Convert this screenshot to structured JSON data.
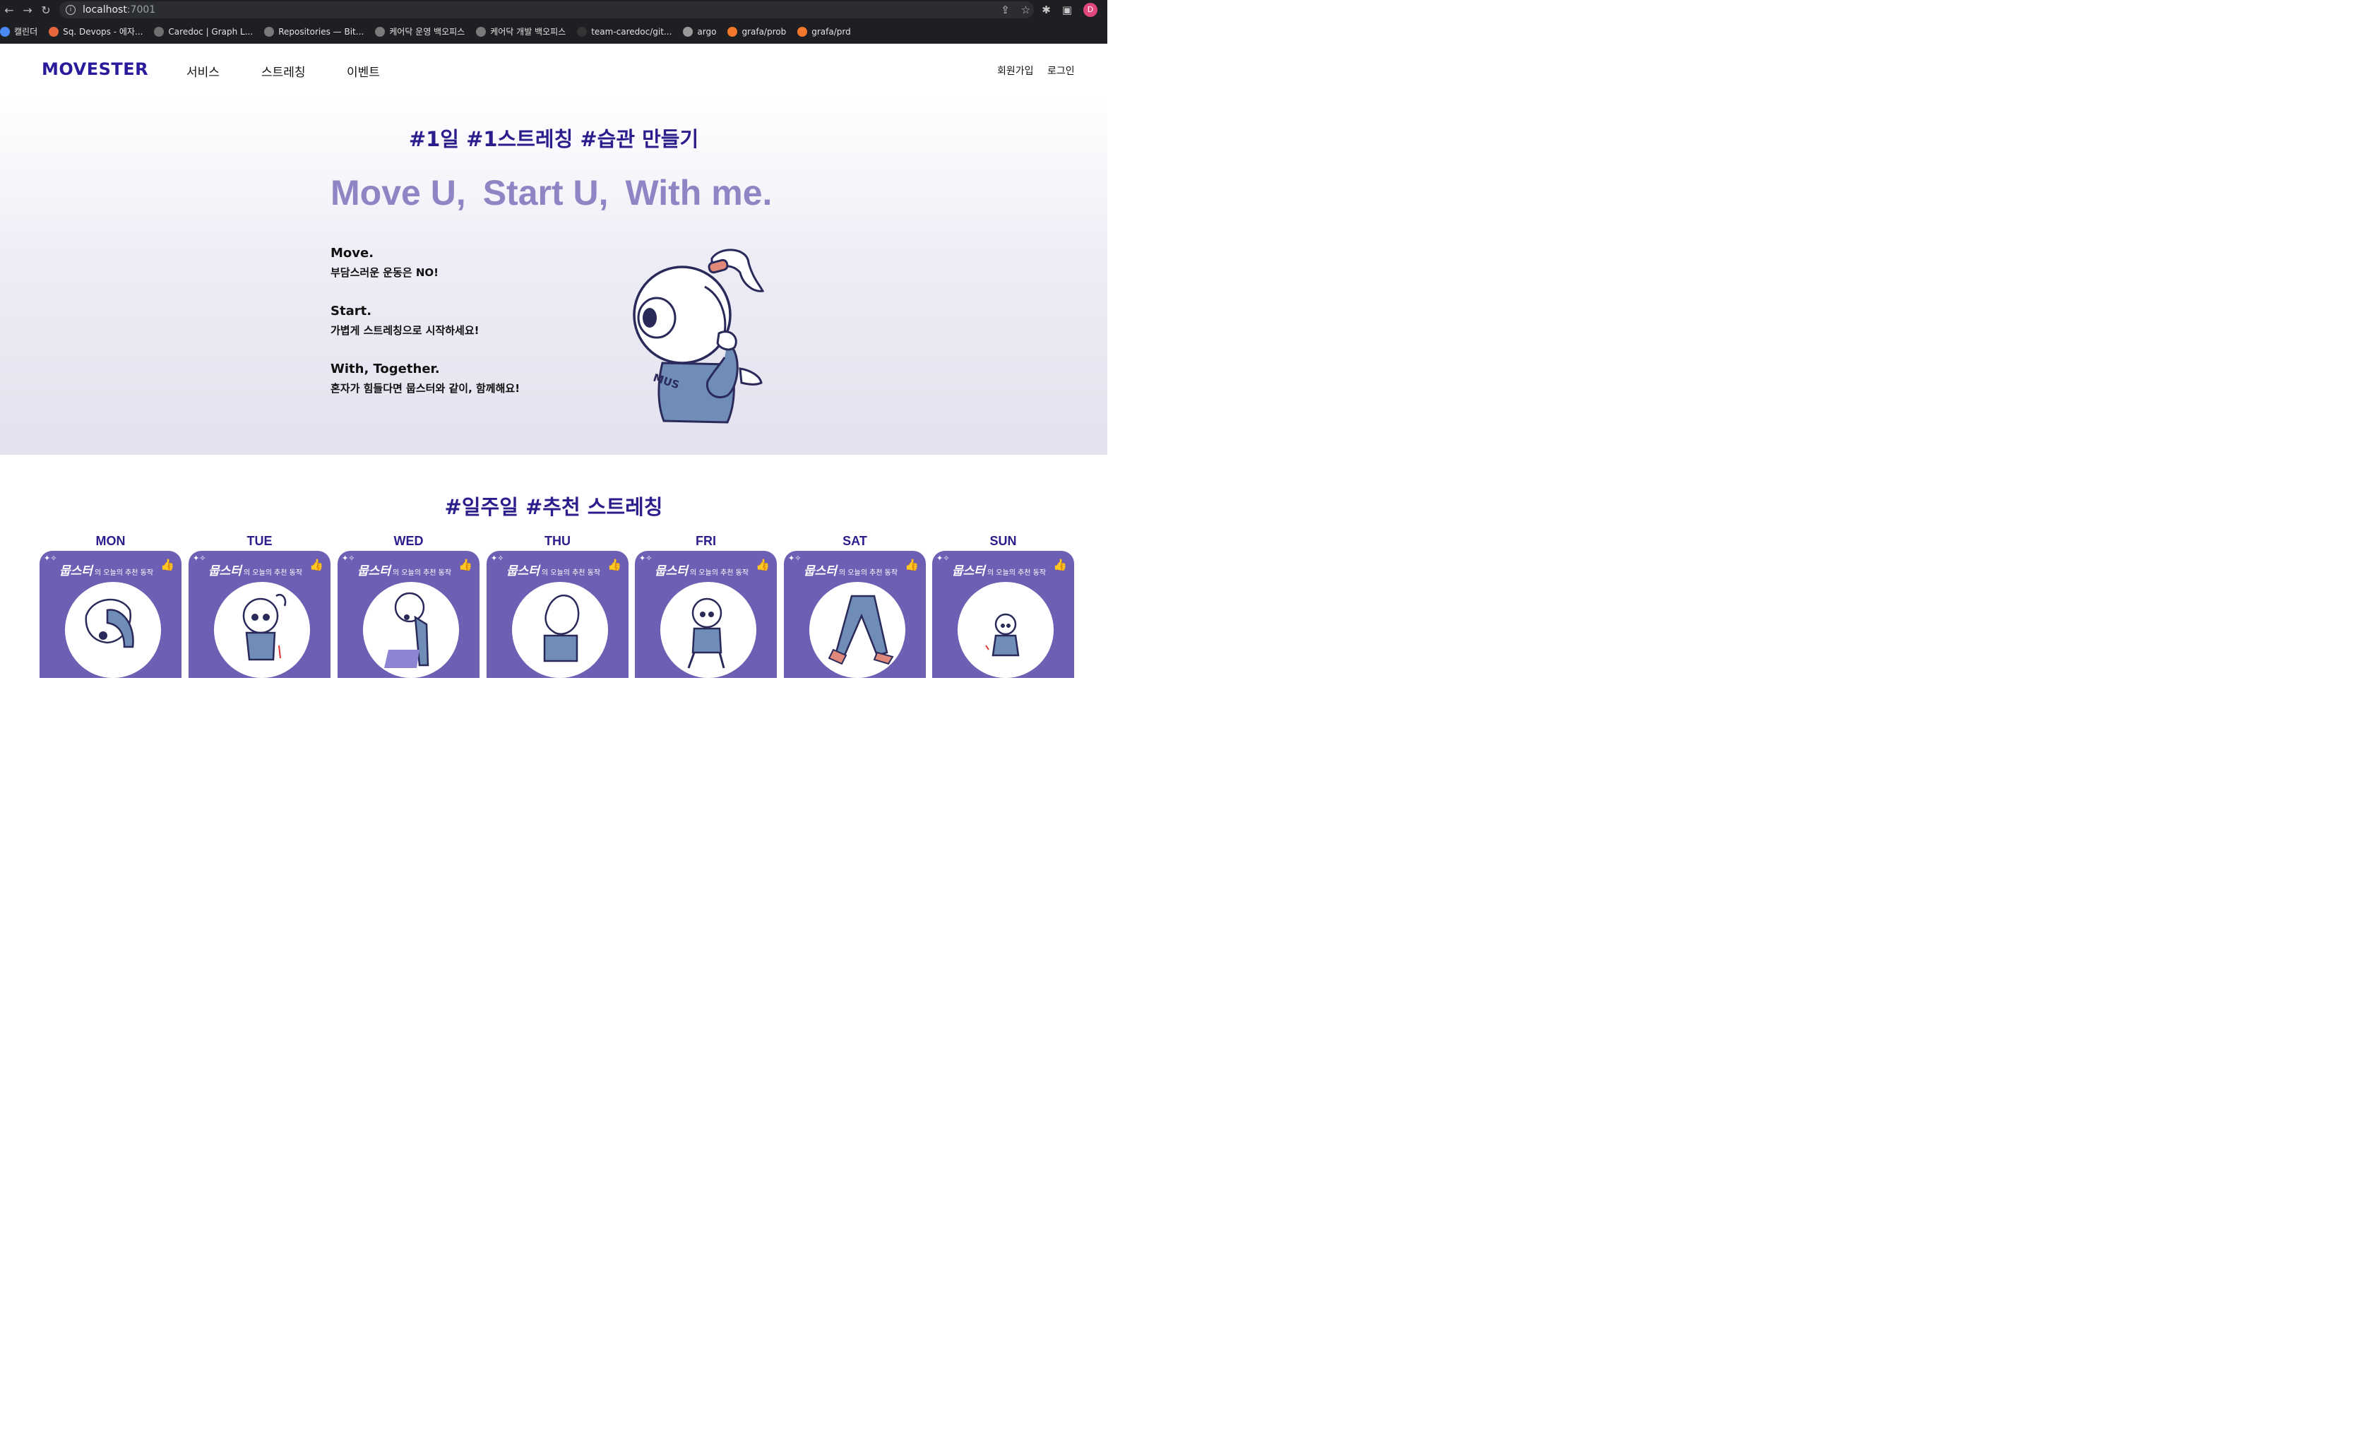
{
  "browser": {
    "url_host": "localhost",
    "url_port": ":7001",
    "profile_initial": "D",
    "bookmarks": [
      {
        "label": "캘린더",
        "color": "#4a8af4"
      },
      {
        "label": "Sq. Devops - 에자...",
        "color": "#e8663c"
      },
      {
        "label": "Caredoc | Graph L...",
        "color": "#6f6f6f"
      },
      {
        "label": "Repositories — Bit...",
        "color": "#7a7a7a"
      },
      {
        "label": "케어닥 운영 백오피스",
        "color": "#7a7a7a"
      },
      {
        "label": "케어닥 개발 백오피스",
        "color": "#7a7a7a"
      },
      {
        "label": "team-caredoc/git...",
        "color": "#333333"
      },
      {
        "label": "argo",
        "color": "#999999"
      },
      {
        "label": "grafa/prob",
        "color": "#f2792c"
      },
      {
        "label": "grafa/prd",
        "color": "#f2792c"
      }
    ]
  },
  "header": {
    "logo": "MOVESTER",
    "menu": [
      "서비스",
      "스트레칭",
      "이벤트"
    ],
    "signup": "회원가입",
    "login": "로그인"
  },
  "hero": {
    "tagline": "#1일 #1스트레칭 #습관 만들기",
    "slogan": [
      "Move U,",
      "Start U,",
      "With me."
    ],
    "features": [
      {
        "title": "Move.",
        "desc": "부담스러운 운동은 NO!"
      },
      {
        "title": "Start.",
        "desc": "가볍게 스트레칭으로 시작하세요!"
      },
      {
        "title": "With, Together.",
        "desc": "혼자가 힘들다면 뭅스터와 같이, 함께해요!"
      }
    ],
    "mascot_text": "MUS"
  },
  "weekly": {
    "title": "#일주일 #추천 스트레칭",
    "card_brand": "뭅스터",
    "card_caption": "의 오늘의 추천 동작",
    "days": [
      "MON",
      "TUE",
      "WED",
      "THU",
      "FRI",
      "SAT",
      "SUN"
    ]
  },
  "colors": {
    "brand": "#2a1b9c",
    "slogan": "#9184c4",
    "card": "#6d5fb3"
  }
}
